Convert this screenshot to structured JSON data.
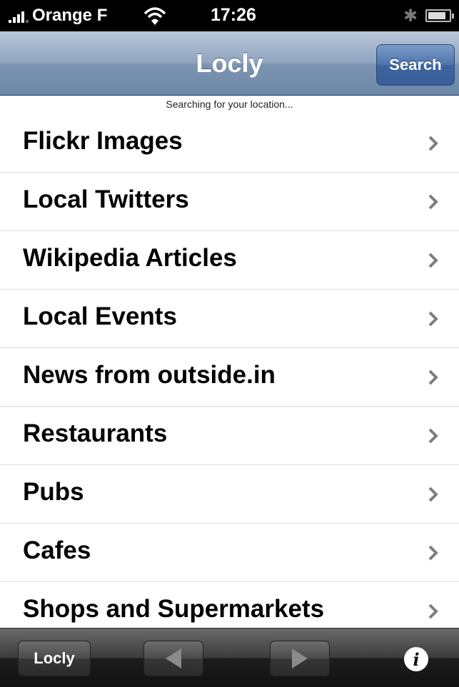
{
  "status_bar": {
    "carrier": "Orange F",
    "time": "17:26",
    "battery_level": 0.85
  },
  "nav_bar": {
    "title": "Locly",
    "search_label": "Search"
  },
  "location_status": "Searching for your location...",
  "list": {
    "items": [
      {
        "label": "Flickr Images"
      },
      {
        "label": "Local Twitters"
      },
      {
        "label": "Wikipedia Articles"
      },
      {
        "label": "Local Events"
      },
      {
        "label": "News from outside.in"
      },
      {
        "label": "Restaurants"
      },
      {
        "label": "Pubs"
      },
      {
        "label": "Cafes"
      },
      {
        "label": "Shops and Supermarkets"
      }
    ]
  },
  "toolbar": {
    "locly_label": "Locly",
    "back_icon": "left-arrow-icon",
    "forward_icon": "right-arrow-icon",
    "info_icon": "info-icon"
  },
  "colors": {
    "nav_bar": "#8ea4bf",
    "search_button": "#4d74ab",
    "toolbar": "#2b2b2b"
  }
}
